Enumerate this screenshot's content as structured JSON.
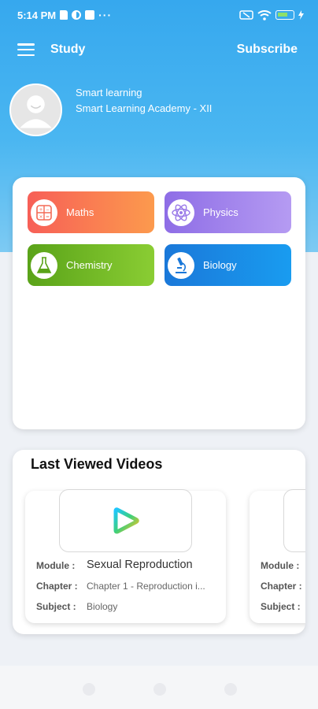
{
  "status_bar": {
    "time": "5:14 PM",
    "icons_left": [
      "sd-card-icon",
      "data-saver-icon",
      "square-icon",
      "more-dots-icon"
    ],
    "icons_right": [
      "battery-saver-icon",
      "wifi-icon",
      "battery-icon",
      "charging-icon"
    ],
    "dots": "···"
  },
  "header": {
    "title": "Study",
    "subscribe_label": "Subscribe",
    "menu_icon": "hamburger-icon"
  },
  "profile": {
    "name": "Smart learning",
    "academy": "Smart Learning Academy - XII",
    "avatar_icon": "default-avatar-icon"
  },
  "subjects": [
    {
      "label": "Maths",
      "icon": "calculator-icon",
      "color": "#f75f57"
    },
    {
      "label": "Physics",
      "icon": "atom-icon",
      "color": "#8e6de6"
    },
    {
      "label": "Chemistry",
      "icon": "flask-icon",
      "color": "#5aa319"
    },
    {
      "label": "Biology",
      "icon": "microscope-icon",
      "color": "#1a78d9"
    }
  ],
  "last_viewed": {
    "title": "Last Viewed Videos",
    "videos": [
      {
        "module_label": "Module :",
        "module": "Sexual Reproduction",
        "chapter_label": "Chapter :",
        "chapter": "Chapter 1 - Reproduction i...",
        "subject_label": "Subject :",
        "subject": "Biology",
        "thumb_icon": "play-logo-icon"
      },
      {
        "module_label": "Module :",
        "chapter_label": "Chapter :",
        "subject_label": "Subject :"
      }
    ]
  },
  "colors": {
    "header_blue": "#36a8ee",
    "background": "#eef1f6"
  }
}
